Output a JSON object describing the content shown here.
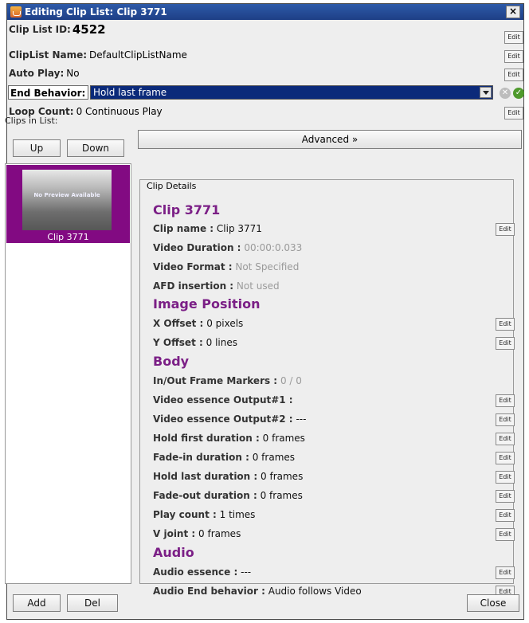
{
  "window": {
    "title": "Editing Clip List: Clip 3771",
    "close_label": "×"
  },
  "header": {
    "clip_list_id_label": "Clip List ID:",
    "clip_list_id_value": "4522",
    "cliplist_name_label": "ClipList Name:",
    "cliplist_name_value": "DefaultClipListName",
    "auto_play_label": "Auto Play:",
    "auto_play_value": "No",
    "end_behavior_label": "End Behavior:",
    "end_behavior_value": "Hold last frame",
    "loop_count_label": "Loop Count:",
    "loop_count_value": "0 Continuous Play",
    "clips_in_list_label": "Clips in List:"
  },
  "buttons": {
    "edit": "Edit",
    "up": "Up",
    "down": "Down",
    "advanced": "Advanced »",
    "add": "Add",
    "del": "Del",
    "close": "Close"
  },
  "clip_list": [
    {
      "thumbnail_text": "No Preview Available",
      "label": "Clip 3771"
    }
  ],
  "details": {
    "legend": "Clip Details",
    "sections": {
      "clip": "Clip 3771",
      "image_position": "Image Position",
      "body": "Body",
      "audio": "Audio"
    },
    "fields": {
      "clip_name": {
        "label": "Clip name :",
        "value": "Clip 3771"
      },
      "video_duration": {
        "label": "Video Duration :",
        "value": "00:00:0.033"
      },
      "video_format": {
        "label": "Video Format :",
        "value": "Not Specified"
      },
      "afd_insertion": {
        "label": "AFD insertion :",
        "value": "Not used"
      },
      "x_offset": {
        "label": "X Offset :",
        "value": "0 pixels"
      },
      "y_offset": {
        "label": "Y Offset :",
        "value": "0 lines"
      },
      "markers": {
        "label": "In/Out Frame Markers :",
        "value": "0 / 0"
      },
      "essence1": {
        "label": "Video essence Output#1 :",
        "value": ""
      },
      "essence2": {
        "label": "Video essence Output#2 :",
        "value": "---"
      },
      "hold_first": {
        "label": "Hold first duration :",
        "value": "0 frames"
      },
      "fade_in": {
        "label": "Fade-in duration :",
        "value": "0 frames"
      },
      "hold_last": {
        "label": "Hold last duration :",
        "value": "0 frames"
      },
      "fade_out": {
        "label": "Fade-out duration :",
        "value": "0 frames"
      },
      "play_count": {
        "label": "Play count :",
        "value": "1 times"
      },
      "v_joint": {
        "label": "V joint :",
        "value": "0 frames"
      },
      "audio_essence": {
        "label": "Audio essence :",
        "value": "---"
      },
      "audio_end": {
        "label": "Audio End behavior :",
        "value": "Audio follows Video"
      }
    }
  },
  "colors": {
    "title_bar": "#1e3f86",
    "selection": "#820a82",
    "section_heading": "#7b1f86",
    "combo_selected": "#0b2a7a"
  },
  "icons": [
    "java-app-icon",
    "cancel-icon",
    "confirm-check-icon",
    "dropdown-arrow-icon",
    "chevron-double-right-icon"
  ]
}
